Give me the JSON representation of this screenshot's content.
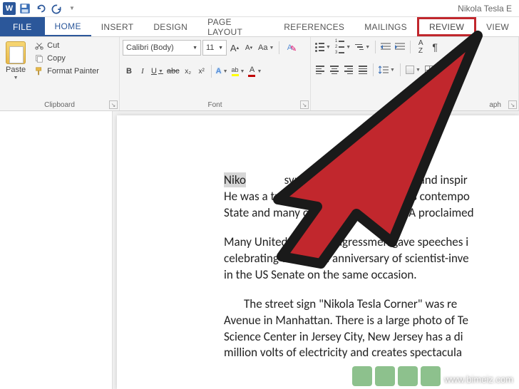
{
  "titlebar": {
    "doc_title": "Nikola Tesla E"
  },
  "tabs": {
    "file": "FILE",
    "home": "HOME",
    "insert": "INSERT",
    "design": "DESIGN",
    "page_layout": "PAGE LAYOUT",
    "references": "REFERENCES",
    "mailings": "MAILINGS",
    "review": "REVIEW",
    "view": "VIEW"
  },
  "ribbon": {
    "clipboard": {
      "label": "Clipboard",
      "paste": "Paste",
      "cut": "Cut",
      "copy": "Copy",
      "format_painter": "Format Painter"
    },
    "font": {
      "label": "Font",
      "font_name": "Calibri (Body)",
      "font_size": "11",
      "bold": "B",
      "italic": "I",
      "underline": "U",
      "strike": "abc",
      "subscript": "x₂",
      "superscript": "x²",
      "grow": "A",
      "shrink": "A",
      "case": "Aa",
      "clear": "A",
      "highlight": "ab",
      "color": "A"
    },
    "paragraph": {
      "label": "aph",
      "pilcrow": "¶"
    }
  },
  "document": {
    "p1_hl": "Niko",
    "p1_rest_a": " symboliz",
    "p1_rest_b": " unifying force and inspir",
    "p1_line2": "He was a true visionar",
    "p1_line2b": "ar ahead of his contempo",
    "p1_line3": "State and many other states in the USA proclaimed",
    "p2_line1": "Many United States Congressmen gave speeches i",
    "p2_line2": "celebrating the 134th anniversary of scientist-inve",
    "p2_line3": "in the US Senate on the same occasion.",
    "p3_line1": "The street sign \"Nikola Tesla Corner\" was re",
    "p3_line2": "Avenue in Manhattan. There is a large photo of Te",
    "p3_line3": "Science Center in Jersey City, New Jersey has a di",
    "p3_line4": "million volts of electricity and creates spectacula"
  },
  "watermark": "www.bimeiz.com"
}
